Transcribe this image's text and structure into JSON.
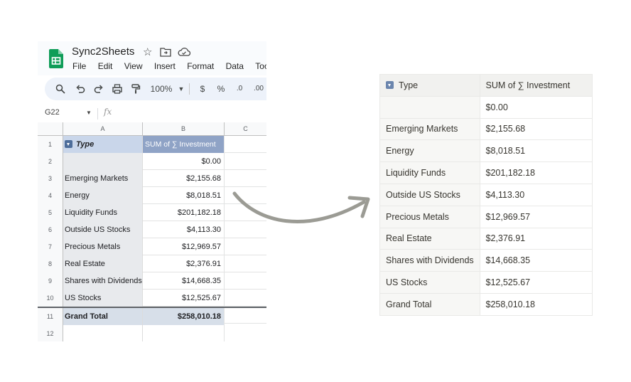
{
  "spreadsheet": {
    "title": "Sync2Sheets",
    "menu": [
      "File",
      "Edit",
      "View",
      "Insert",
      "Format",
      "Data",
      "Tools"
    ],
    "toolbar": {
      "zoom": "100%",
      "currency": "$",
      "percent": "%",
      "decrease_decimals": ".0",
      "increase_decimals": ".00"
    },
    "name_box": "G22",
    "fx": "fx",
    "columns": [
      "A",
      "B",
      "C"
    ],
    "header": {
      "row": "1",
      "a": "Type",
      "b": "SUM of ∑  Investment"
    },
    "rows": [
      {
        "row": "2",
        "a": "",
        "b": "$0.00"
      },
      {
        "row": "3",
        "a": "Emerging Markets",
        "b": "$2,155.68"
      },
      {
        "row": "4",
        "a": "Energy",
        "b": "$8,018.51"
      },
      {
        "row": "5",
        "a": "Liquidity Funds",
        "b": "$201,182.18"
      },
      {
        "row": "6",
        "a": "Outside US Stocks",
        "b": "$4,113.30"
      },
      {
        "row": "7",
        "a": "Precious Metals",
        "b": "$12,969.57"
      },
      {
        "row": "8",
        "a": "Real Estate",
        "b": "$2,376.91"
      },
      {
        "row": "9",
        "a": "Shares with Dividends",
        "b": "$14,668.35"
      },
      {
        "row": "10",
        "a": "US Stocks",
        "b": "$12,525.67"
      }
    ],
    "total": {
      "row": "11",
      "a": "Grand Total",
      "b": "$258,010.18"
    },
    "empty_row": "12",
    "colors": {
      "header_a": "#c9d6ea",
      "header_b": "#8fa3c6",
      "total": "#d7dfe9",
      "logo": "#0f9d58"
    }
  },
  "table": {
    "headers": [
      "Type",
      "SUM of ∑  Investment"
    ],
    "rows": [
      [
        "",
        "$0.00"
      ],
      [
        "Emerging Markets",
        "$2,155.68"
      ],
      [
        "Energy",
        "$8,018.51"
      ],
      [
        "Liquidity Funds",
        "$201,182.18"
      ],
      [
        "Outside US Stocks",
        "$4,113.30"
      ],
      [
        "Precious Metals",
        "$12,969.57"
      ],
      [
        "Real Estate",
        "$2,376.91"
      ],
      [
        "Shares with Dividends",
        "$14,668.35"
      ],
      [
        "US Stocks",
        "$12,525.67"
      ],
      [
        "Grand Total",
        "$258,010.18"
      ]
    ]
  },
  "icons": [
    "sheets-logo-icon",
    "star-icon",
    "folder-icon",
    "cloud-icon",
    "search-icon",
    "undo-icon",
    "redo-icon",
    "print-icon",
    "paint-format-icon",
    "fx-icon",
    "filter-icon",
    "curved-arrow-icon"
  ]
}
